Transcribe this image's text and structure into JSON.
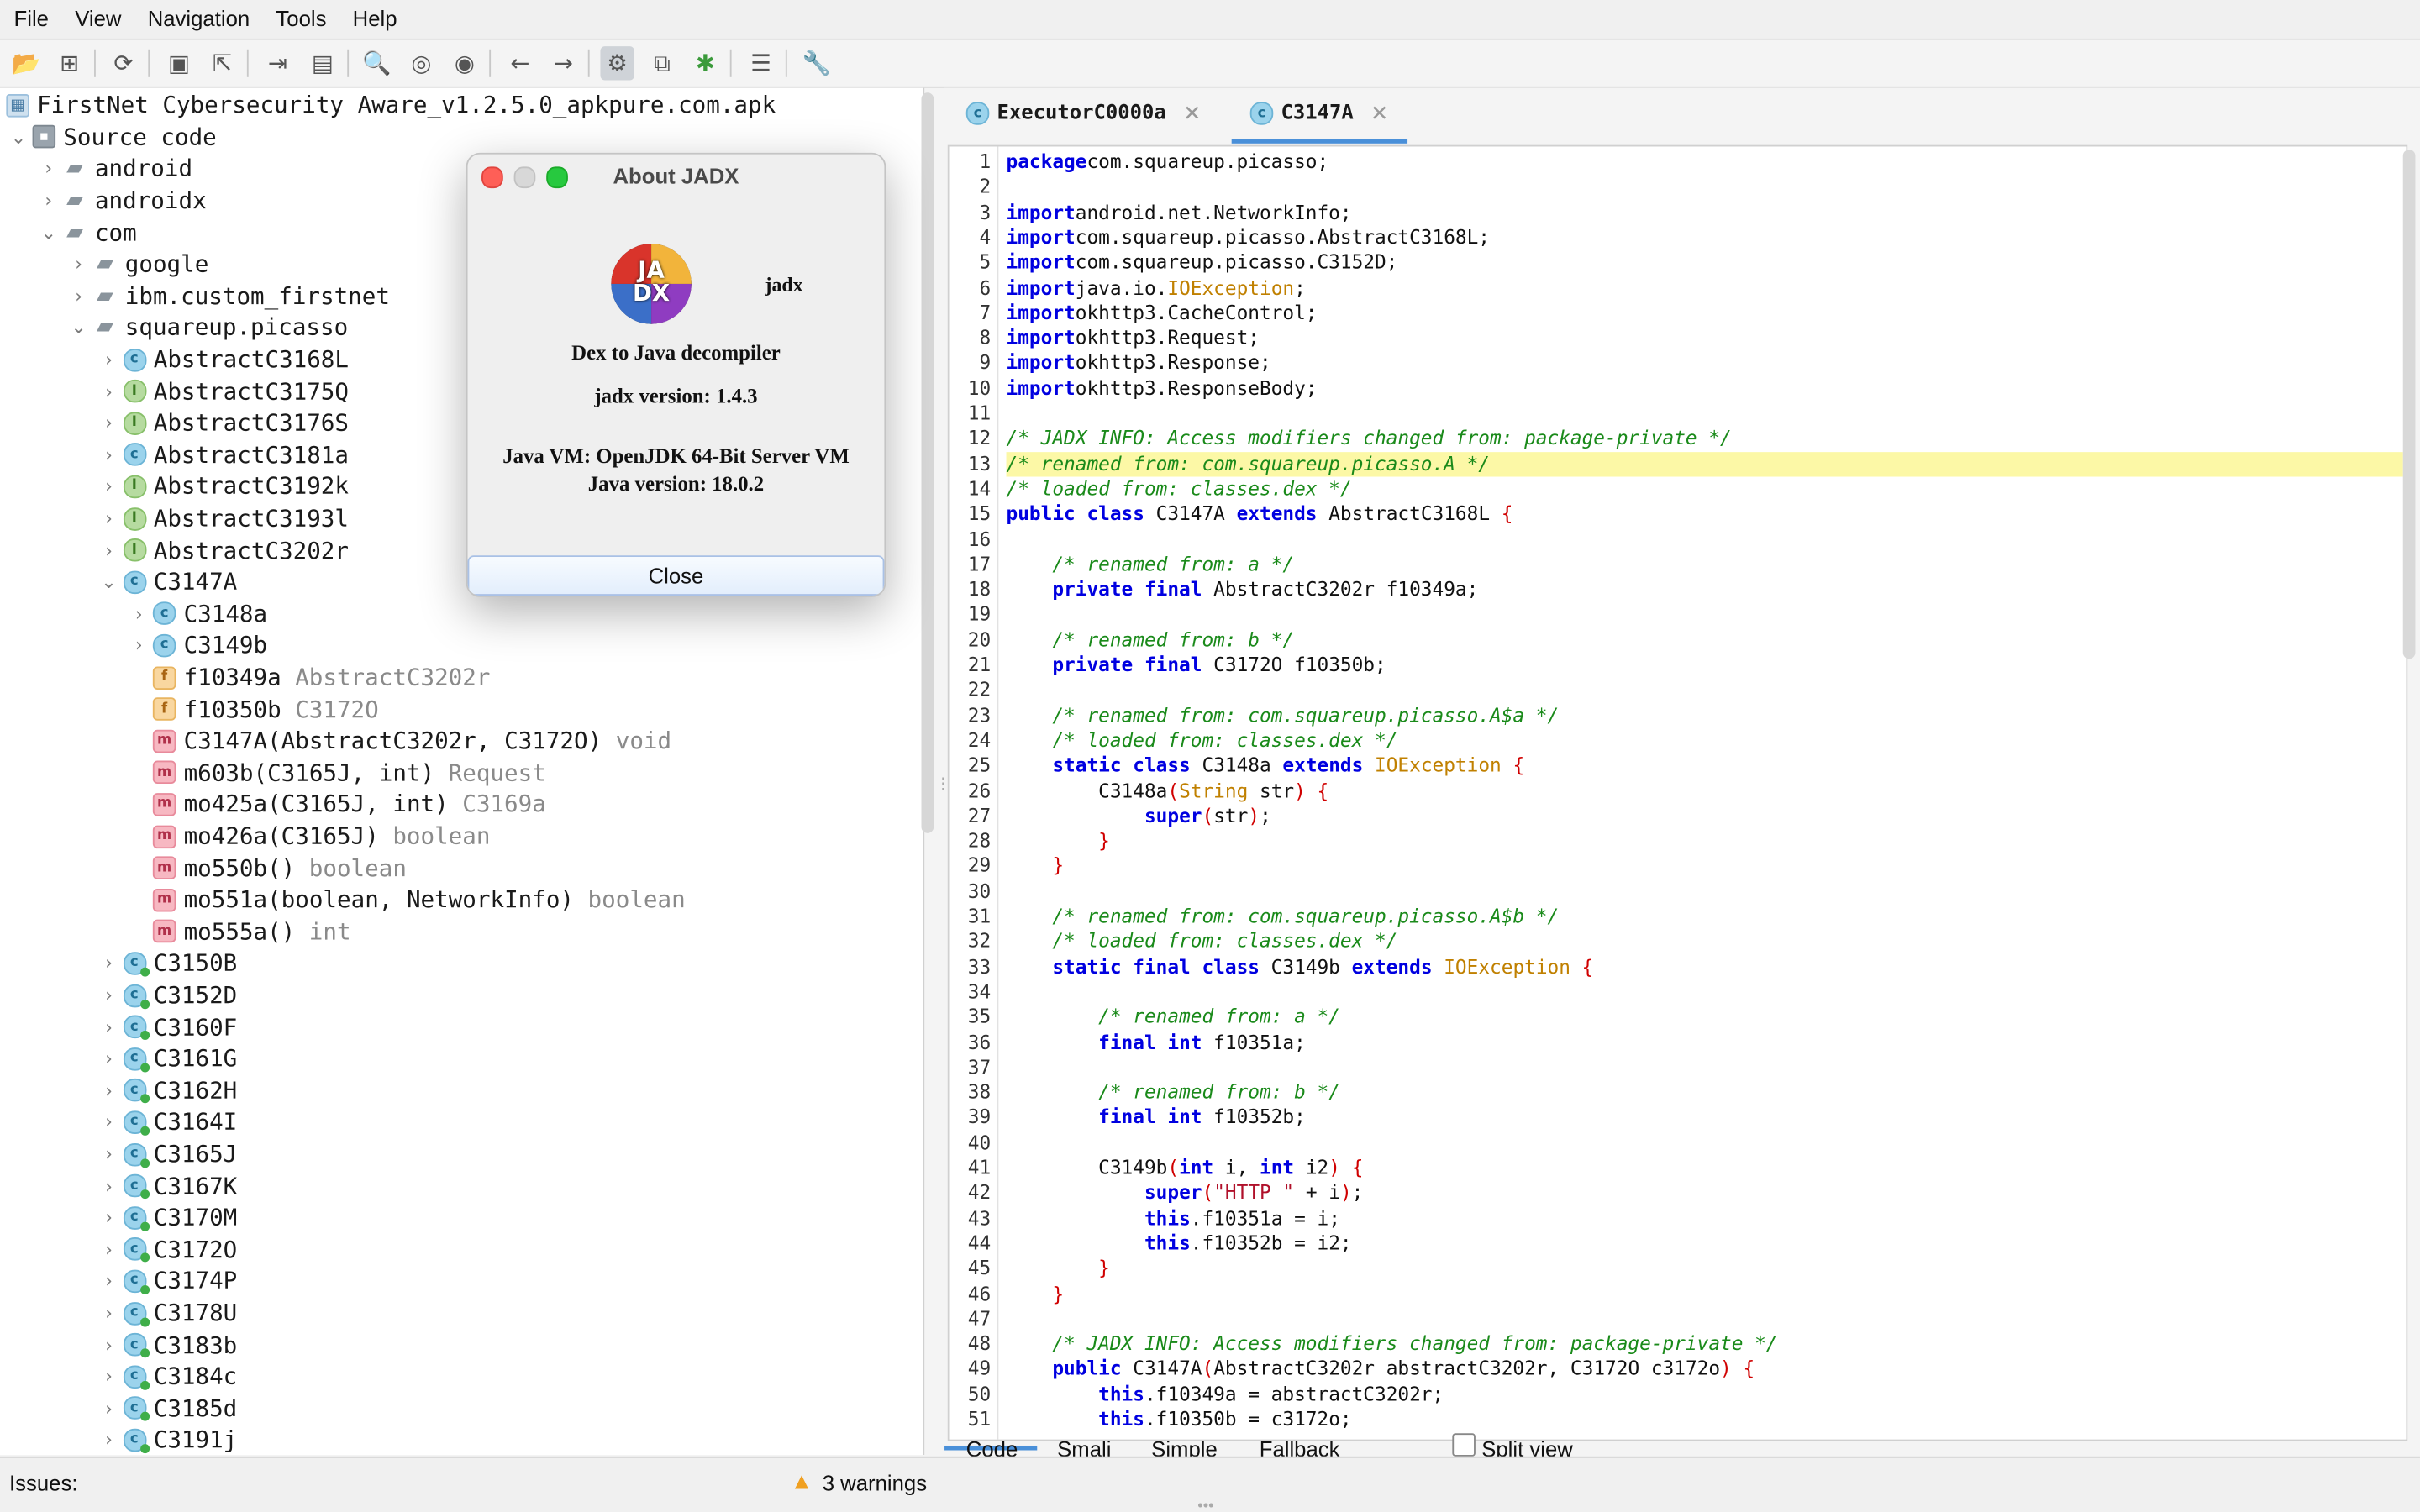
{
  "menu": [
    "File",
    "View",
    "Navigation",
    "Tools",
    "Help"
  ],
  "toolbar_icons": [
    "open-icon",
    "add-files-icon",
    "reload-icon",
    "save-icon",
    "export-icon",
    "sync-icon",
    "flatten-icon",
    "search-icon",
    "find-usage-icon",
    "find-text-icon",
    "back-icon",
    "forward-icon",
    "deobfuscation-icon",
    "quick-tabs-icon",
    "debugger-icon",
    "log-icon",
    "preferences-icon"
  ],
  "tree": {
    "project": "FirstNet Cybersecurity Aware_v1.2.5.0_apkpure.com.apk",
    "rows": [
      {
        "indent": 1,
        "toggle": "⌄",
        "icon": "pkg",
        "name": "Source code",
        "type": ""
      },
      {
        "indent": 2,
        "toggle": "›",
        "icon": "folder",
        "name": "android",
        "type": ""
      },
      {
        "indent": 2,
        "toggle": "›",
        "icon": "folder",
        "name": "androidx",
        "type": ""
      },
      {
        "indent": 2,
        "toggle": "⌄",
        "icon": "folder",
        "name": "com",
        "type": ""
      },
      {
        "indent": 3,
        "toggle": "›",
        "icon": "folder",
        "name": "google",
        "type": ""
      },
      {
        "indent": 3,
        "toggle": "›",
        "icon": "folder",
        "name": "ibm.custom_firstnet",
        "type": ""
      },
      {
        "indent": 3,
        "toggle": "⌄",
        "icon": "folder",
        "name": "squareup.picasso",
        "type": ""
      },
      {
        "indent": 4,
        "toggle": "›",
        "icon": "c",
        "name": "AbstractC3168L",
        "type": ""
      },
      {
        "indent": 4,
        "toggle": "›",
        "icon": "i",
        "name": "AbstractC3175Q",
        "type": ""
      },
      {
        "indent": 4,
        "toggle": "›",
        "icon": "i",
        "name": "AbstractC3176S",
        "type": ""
      },
      {
        "indent": 4,
        "toggle": "›",
        "icon": "c",
        "name": "AbstractC3181a",
        "type": ""
      },
      {
        "indent": 4,
        "toggle": "›",
        "icon": "i",
        "name": "AbstractC3192k",
        "type": ""
      },
      {
        "indent": 4,
        "toggle": "›",
        "icon": "i",
        "name": "AbstractC3193l",
        "type": ""
      },
      {
        "indent": 4,
        "toggle": "›",
        "icon": "i",
        "name": "AbstractC3202r",
        "type": ""
      },
      {
        "indent": 4,
        "toggle": "⌄",
        "icon": "c",
        "name": "C3147A",
        "type": ""
      },
      {
        "indent": 5,
        "toggle": "›",
        "icon": "c",
        "name": "C3148a",
        "type": ""
      },
      {
        "indent": 5,
        "toggle": "›",
        "icon": "c",
        "name": "C3149b",
        "type": ""
      },
      {
        "indent": 5,
        "toggle": "",
        "icon": "f",
        "name": "f10349a",
        "type": "AbstractC3202r"
      },
      {
        "indent": 5,
        "toggle": "",
        "icon": "f",
        "name": "f10350b",
        "type": "C3172O"
      },
      {
        "indent": 5,
        "toggle": "",
        "icon": "m",
        "name": "C3147A(AbstractC3202r, C3172O)",
        "type": "void"
      },
      {
        "indent": 5,
        "toggle": "",
        "icon": "m",
        "name": "m603b(C3165J, int)",
        "type": "Request"
      },
      {
        "indent": 5,
        "toggle": "",
        "icon": "m",
        "name": "mo425a(C3165J, int)",
        "type": "C3169a"
      },
      {
        "indent": 5,
        "toggle": "",
        "icon": "m",
        "name": "mo426a(C3165J)",
        "type": "boolean"
      },
      {
        "indent": 5,
        "toggle": "",
        "icon": "m",
        "name": "mo550b()",
        "type": "boolean"
      },
      {
        "indent": 5,
        "toggle": "",
        "icon": "m",
        "name": "mo551a(boolean, NetworkInfo)",
        "type": "boolean"
      },
      {
        "indent": 5,
        "toggle": "",
        "icon": "m",
        "name": "mo555a()",
        "type": "int"
      },
      {
        "indent": 4,
        "toggle": "›",
        "icon": "c",
        "name": "C3150B",
        "type": ""
      },
      {
        "indent": 4,
        "toggle": "›",
        "icon": "c",
        "name": "C3152D",
        "type": ""
      },
      {
        "indent": 4,
        "toggle": "›",
        "icon": "c",
        "name": "C3160F",
        "type": ""
      },
      {
        "indent": 4,
        "toggle": "›",
        "icon": "c",
        "name": "C3161G",
        "type": ""
      },
      {
        "indent": 4,
        "toggle": "›",
        "icon": "c",
        "name": "C3162H",
        "type": ""
      },
      {
        "indent": 4,
        "toggle": "›",
        "icon": "c",
        "name": "C3164I",
        "type": ""
      },
      {
        "indent": 4,
        "toggle": "›",
        "icon": "c",
        "name": "C3165J",
        "type": ""
      },
      {
        "indent": 4,
        "toggle": "›",
        "icon": "c",
        "name": "C3167K",
        "type": ""
      },
      {
        "indent": 4,
        "toggle": "›",
        "icon": "c",
        "name": "C3170M",
        "type": ""
      },
      {
        "indent": 4,
        "toggle": "›",
        "icon": "c",
        "name": "C3172O",
        "type": ""
      },
      {
        "indent": 4,
        "toggle": "›",
        "icon": "c",
        "name": "C3174P",
        "type": ""
      },
      {
        "indent": 4,
        "toggle": "›",
        "icon": "c",
        "name": "C3178U",
        "type": ""
      },
      {
        "indent": 4,
        "toggle": "›",
        "icon": "c",
        "name": "C3183b",
        "type": ""
      },
      {
        "indent": 4,
        "toggle": "›",
        "icon": "c",
        "name": "C3184c",
        "type": ""
      },
      {
        "indent": 4,
        "toggle": "›",
        "icon": "c",
        "name": "C3185d",
        "type": ""
      },
      {
        "indent": 4,
        "toggle": "›",
        "icon": "c",
        "name": "C3191j",
        "type": ""
      }
    ]
  },
  "editor": {
    "tabs": [
      {
        "label": "ExecutorC0000a",
        "active": false
      },
      {
        "label": "C3147A",
        "active": true
      }
    ],
    "highlight_line": 13,
    "lines": [
      [
        [
          "kw",
          "package"
        ],
        [
          "",
          "com.squareup.picasso;"
        ]
      ],
      [],
      [
        [
          "kw",
          "import"
        ],
        [
          "",
          "android.net.NetworkInfo;"
        ]
      ],
      [
        [
          "kw",
          "import"
        ],
        [
          "",
          "com.squareup.picasso.AbstractC3168L;"
        ]
      ],
      [
        [
          "kw",
          "import"
        ],
        [
          "",
          "com.squareup.picasso.C3152D;"
        ]
      ],
      [
        [
          "kw",
          "import"
        ],
        [
          "",
          "java.io."
        ],
        [
          "ty",
          "IOException"
        ],
        [
          "",
          ";"
        ]
      ],
      [
        [
          "kw",
          "import"
        ],
        [
          "",
          "okhttp3.CacheControl;"
        ]
      ],
      [
        [
          "kw",
          "import"
        ],
        [
          "",
          "okhttp3.Request;"
        ]
      ],
      [
        [
          "kw",
          "import"
        ],
        [
          "",
          "okhttp3.Response;"
        ]
      ],
      [
        [
          "kw",
          "import"
        ],
        [
          "",
          "okhttp3.ResponseBody;"
        ]
      ],
      [],
      [
        [
          "cm",
          "/* JADX INFO: Access modifiers changed from: package-private */"
        ]
      ],
      [
        [
          "cm",
          "/* renamed from: com.squareup.picasso.A */"
        ]
      ],
      [
        [
          "cm",
          "/* loaded from: classes.dex */"
        ]
      ],
      [
        [
          "kw",
          "public class"
        ],
        [
          "",
          " C3147A "
        ],
        [
          "kw",
          "extends"
        ],
        [
          "",
          " AbstractC3168L "
        ],
        [
          "br",
          "{"
        ]
      ],
      [],
      [
        [
          "",
          "    "
        ],
        [
          "cm",
          "/* renamed from: a */"
        ]
      ],
      [
        [
          "",
          "    "
        ],
        [
          "kw",
          "private final"
        ],
        [
          "",
          " AbstractC3202r f10349a;"
        ]
      ],
      [],
      [
        [
          "",
          "    "
        ],
        [
          "cm",
          "/* renamed from: b */"
        ]
      ],
      [
        [
          "",
          "    "
        ],
        [
          "kw",
          "private final"
        ],
        [
          "",
          " C3172O f10350b;"
        ]
      ],
      [],
      [
        [
          "",
          "    "
        ],
        [
          "cm",
          "/* renamed from: com.squareup.picasso.A$a */"
        ]
      ],
      [
        [
          "",
          "    "
        ],
        [
          "cm",
          "/* loaded from: classes.dex */"
        ]
      ],
      [
        [
          "",
          "    "
        ],
        [
          "kw",
          "static class"
        ],
        [
          "",
          " C3148a "
        ],
        [
          "kw",
          "extends"
        ],
        [
          "",
          "",
          " "
        ],
        [
          "ty",
          " IOException"
        ],
        [
          "",
          " "
        ],
        [
          "br",
          "{"
        ]
      ],
      [
        [
          "",
          "        C3148a"
        ],
        [
          "br",
          "("
        ],
        [
          "ty",
          "String"
        ],
        [
          "",
          " str"
        ],
        [
          "br",
          ")"
        ],
        [
          "",
          " "
        ],
        [
          "br",
          "{"
        ]
      ],
      [
        [
          "",
          "            "
        ],
        [
          "kw",
          "super"
        ],
        [
          "br",
          "("
        ],
        [
          "",
          "str"
        ],
        [
          "br",
          ")"
        ],
        [
          "",
          ";"
        ]
      ],
      [
        [
          "",
          "        "
        ],
        [
          "br",
          "}"
        ]
      ],
      [
        [
          "",
          "    "
        ],
        [
          "br",
          "}"
        ]
      ],
      [],
      [
        [
          "",
          "    "
        ],
        [
          "cm",
          "/* renamed from: com.squareup.picasso.A$b */"
        ]
      ],
      [
        [
          "",
          "    "
        ],
        [
          "cm",
          "/* loaded from: classes.dex */"
        ]
      ],
      [
        [
          "",
          "    "
        ],
        [
          "kw",
          "static final class"
        ],
        [
          "",
          " C3149b "
        ],
        [
          "kw",
          "extends"
        ],
        [
          "",
          " "
        ],
        [
          "ty",
          "IOException"
        ],
        [
          "",
          " "
        ],
        [
          "br",
          "{"
        ]
      ],
      [],
      [
        [
          "",
          "        "
        ],
        [
          "cm",
          "/* renamed from: a */"
        ]
      ],
      [
        [
          "",
          "        "
        ],
        [
          "kw",
          "final int"
        ],
        [
          "",
          " f10351a;"
        ]
      ],
      [],
      [
        [
          "",
          "        "
        ],
        [
          "cm",
          "/* renamed from: b */"
        ]
      ],
      [
        [
          "",
          "        "
        ],
        [
          "kw",
          "final int"
        ],
        [
          "",
          " f10352b;"
        ]
      ],
      [],
      [
        [
          "",
          "        C3149b"
        ],
        [
          "br",
          "("
        ],
        [
          "kw",
          "int"
        ],
        [
          "",
          " i, "
        ],
        [
          "kw",
          "int"
        ],
        [
          "",
          " i2"
        ],
        [
          "br",
          ")"
        ],
        [
          "",
          " "
        ],
        [
          "br",
          "{"
        ]
      ],
      [
        [
          "",
          "            "
        ],
        [
          "kw",
          "super"
        ],
        [
          "br",
          "("
        ],
        [
          "st",
          "\"HTTP \""
        ],
        [
          "",
          " + i"
        ],
        [
          "br",
          ")"
        ],
        [
          "",
          ";"
        ]
      ],
      [
        [
          "",
          "            "
        ],
        [
          "kw",
          "this"
        ],
        [
          "",
          ".f10351a = i;"
        ]
      ],
      [
        [
          "",
          "            "
        ],
        [
          "kw",
          "this"
        ],
        [
          "",
          ".f10352b = i2;"
        ]
      ],
      [
        [
          "",
          "        "
        ],
        [
          "br",
          "}"
        ]
      ],
      [
        [
          "",
          "    "
        ],
        [
          "br",
          "}"
        ]
      ],
      [],
      [
        [
          "",
          "    "
        ],
        [
          "cm",
          "/* JADX INFO: Access modifiers changed from: package-private */"
        ]
      ],
      [
        [
          "",
          "    "
        ],
        [
          "kw",
          "public"
        ],
        [
          "",
          " C3147A"
        ],
        [
          "br",
          "("
        ],
        [
          "",
          "AbstractC3202r abstractC3202r, C3172O c3172o"
        ],
        [
          "br",
          ")"
        ],
        [
          "",
          " "
        ],
        [
          "br",
          "{"
        ]
      ],
      [
        [
          "",
          "        "
        ],
        [
          "kw",
          "this"
        ],
        [
          "",
          ".f10349a = abstractC3202r;"
        ]
      ],
      [
        [
          "",
          "        "
        ],
        [
          "kw",
          "this"
        ],
        [
          "",
          ".f10350b = c3172o;"
        ]
      ]
    ],
    "bottom_tabs": [
      "Code",
      "Smali",
      "Simple",
      "Fallback"
    ],
    "active_bottom_tab": "Code",
    "split_view_label": "Split view"
  },
  "status": {
    "issues_label": "Issues:",
    "warnings": "3 warnings"
  },
  "dialog": {
    "title": "About JADX",
    "logo_text": "jadx",
    "logo_letters": "JA\nDX",
    "subtitle": "Dex to Java decompiler",
    "version": "jadx version: 1.4.3",
    "vm": "Java VM: OpenJDK 64-Bit Server VM",
    "java_version": "Java version: 18.0.2",
    "close_label": "Close"
  }
}
